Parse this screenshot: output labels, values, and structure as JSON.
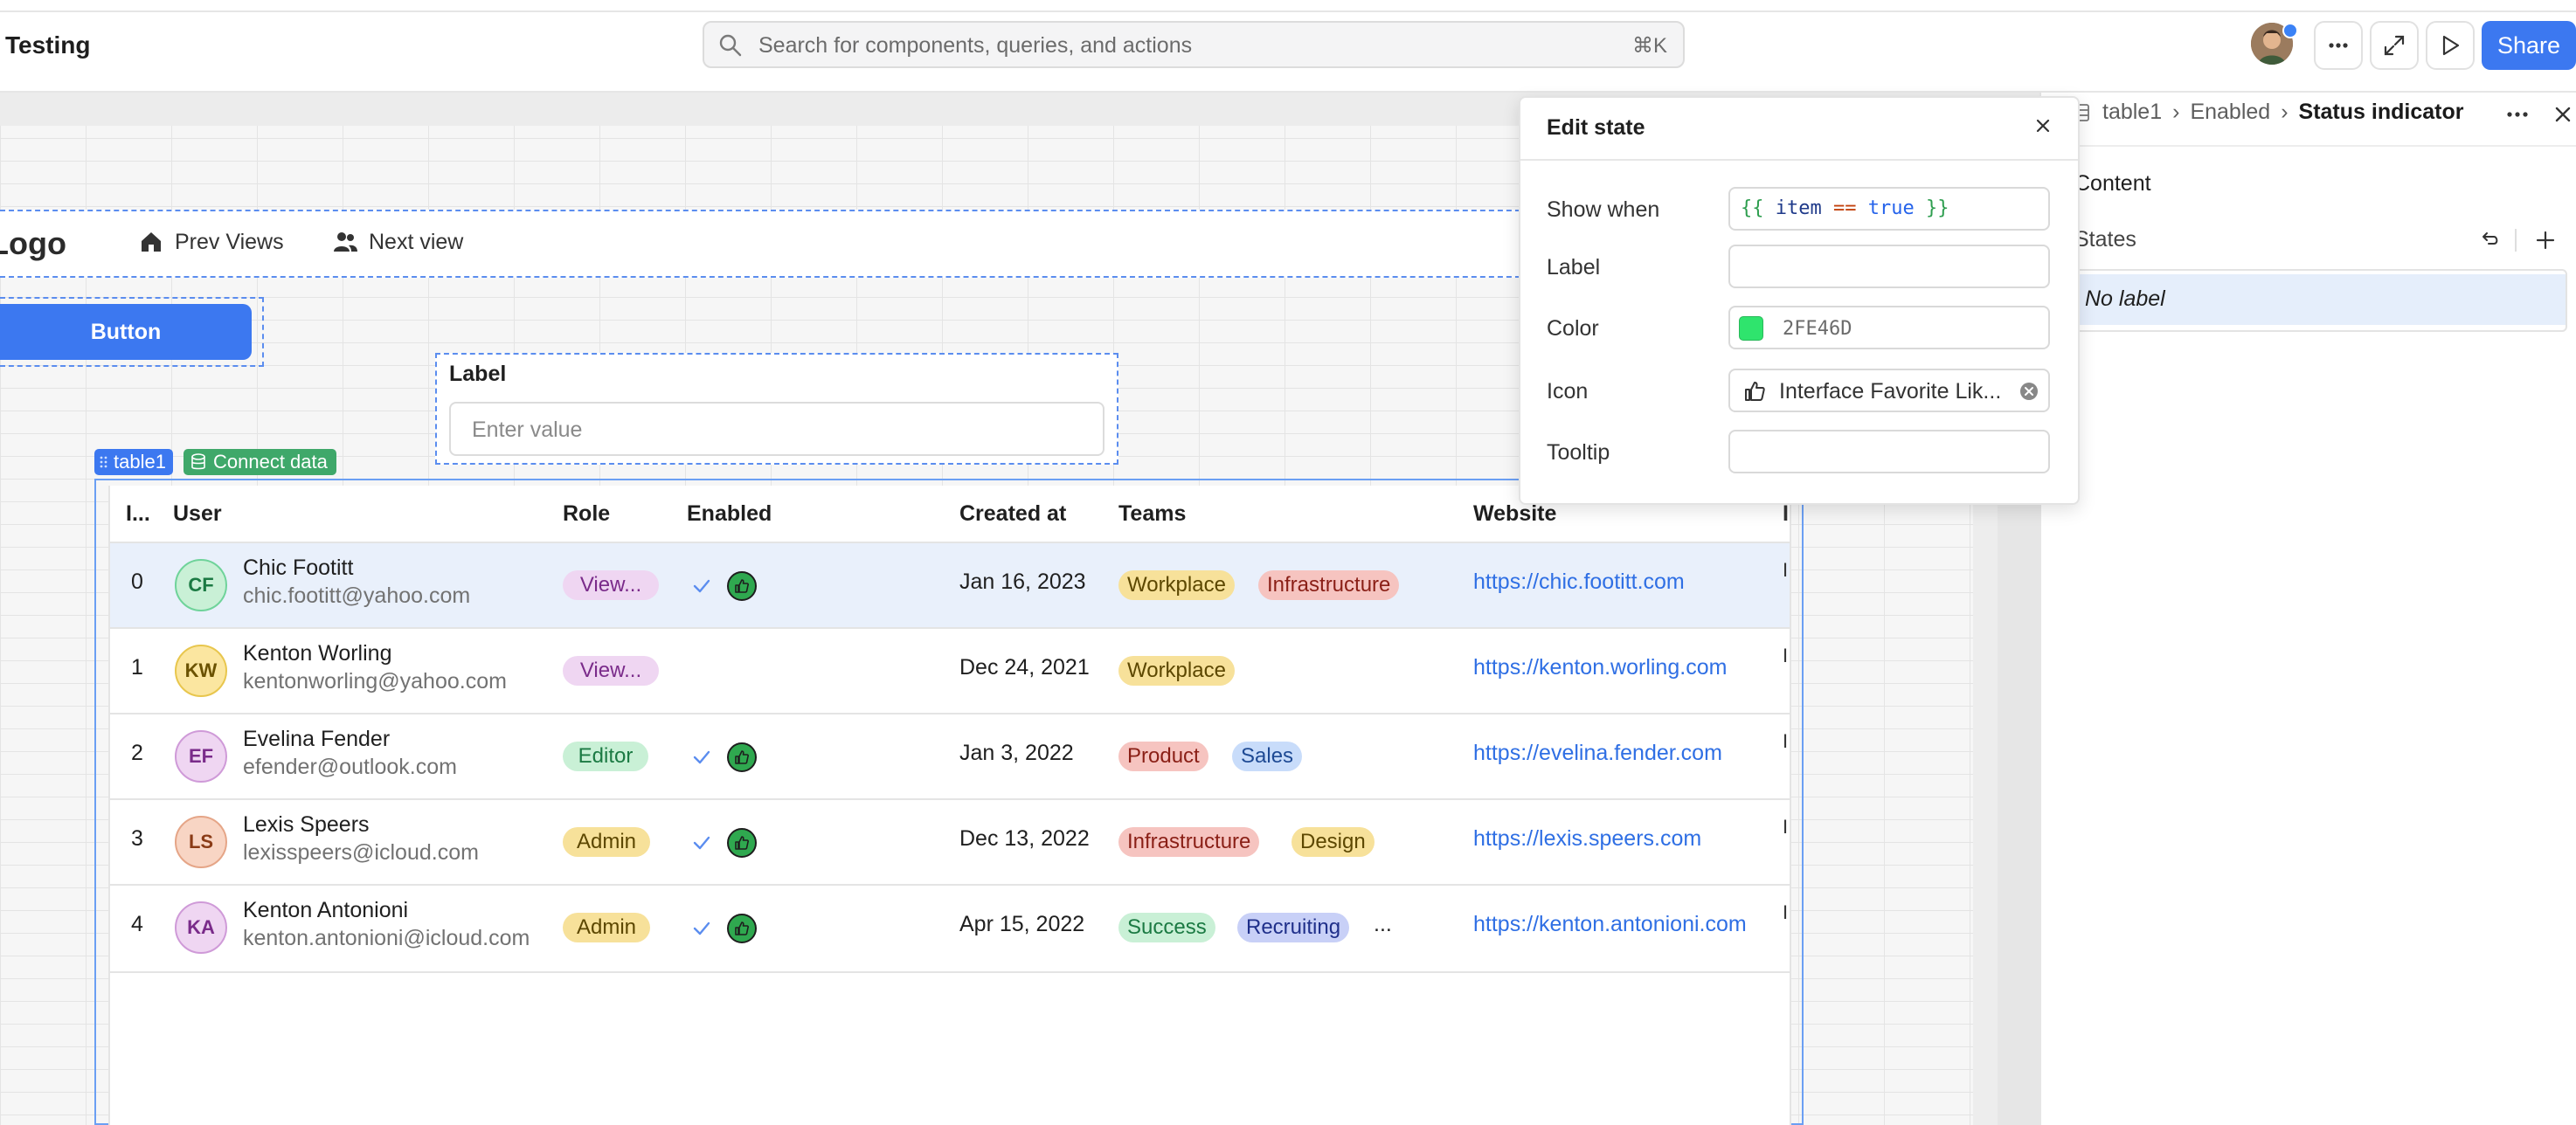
{
  "app": {
    "title": "Testing"
  },
  "search": {
    "placeholder": "Search for components, queries, and actions",
    "shortcut": "⌘K"
  },
  "toolbar": {
    "more_icon": "more-horizontal-icon",
    "expand_icon": "expand-icon",
    "preview_icon": "play-icon",
    "share_label": "Share"
  },
  "nav": {
    "logo": "Logo",
    "items": [
      {
        "label": "Prev Views",
        "icon": "home-icon"
      },
      {
        "label": "Next view",
        "icon": "users-icon"
      }
    ]
  },
  "button": {
    "label": "Button"
  },
  "text_input": {
    "label": "Label",
    "placeholder": "Enter value"
  },
  "table_tags": {
    "name": "table1",
    "connect": "Connect data"
  },
  "table": {
    "columns": [
      "I...",
      "User",
      "Role",
      "Enabled",
      "Created at",
      "Teams",
      "Website"
    ],
    "rows": [
      {
        "id": "0",
        "initials": "CF",
        "name": "Chic Footitt",
        "email": "chic.footitt@yahoo.com",
        "role": "View...",
        "enabled": true,
        "created": "Jan 16, 2023",
        "teams": [
          "Workplace",
          "Infrastructure"
        ],
        "website": "https://chic.footitt.com",
        "selected": true
      },
      {
        "id": "1",
        "initials": "KW",
        "name": "Kenton Worling",
        "email": "kentonworling@yahoo.com",
        "role": "View...",
        "enabled": false,
        "created": "Dec 24, 2021",
        "teams": [
          "Workplace"
        ],
        "website": "https://kenton.worling.com"
      },
      {
        "id": "2",
        "initials": "EF",
        "name": "Evelina Fender",
        "email": "efender@outlook.com",
        "role": "Editor",
        "enabled": true,
        "created": "Jan 3, 2022",
        "teams": [
          "Product",
          "Sales"
        ],
        "website": "https://evelina.fender.com"
      },
      {
        "id": "3",
        "initials": "LS",
        "name": "Lexis Speers",
        "email": "lexisspeers@icloud.com",
        "role": "Admin",
        "enabled": true,
        "created": "Dec 13, 2022",
        "teams": [
          "Infrastructure",
          "Design"
        ],
        "website": "https://lexis.speers.com"
      },
      {
        "id": "4",
        "initials": "KA",
        "name": "Kenton Antonioni",
        "email": "kenton.antonioni@icloud.com",
        "role": "Admin",
        "enabled": true,
        "created": "Apr 15, 2022",
        "teams": [
          "Success",
          "Recruiting"
        ],
        "teams_more": "...",
        "website": "https://kenton.antonioni.com"
      }
    ]
  },
  "edit_state": {
    "title": "Edit state",
    "fields": {
      "show_when": {
        "label": "Show when",
        "open": "{{",
        "ident": "item",
        "op": "==",
        "value": "true",
        "close": "}}"
      },
      "label": {
        "label": "Label",
        "value": ""
      },
      "color": {
        "label": "Color",
        "value": "2FE46D",
        "swatch": "#2FE46D"
      },
      "icon": {
        "label": "Icon",
        "value": "Interface Favorite Lik...",
        "icon": "thumbs-up-icon"
      },
      "tooltip": {
        "label": "Tooltip",
        "value": ""
      }
    }
  },
  "inspector": {
    "breadcrumb": [
      "table1",
      "Enabled",
      "Status indicator"
    ],
    "content_heading": "Content",
    "states_heading": "States",
    "state_items": [
      "No label"
    ]
  }
}
